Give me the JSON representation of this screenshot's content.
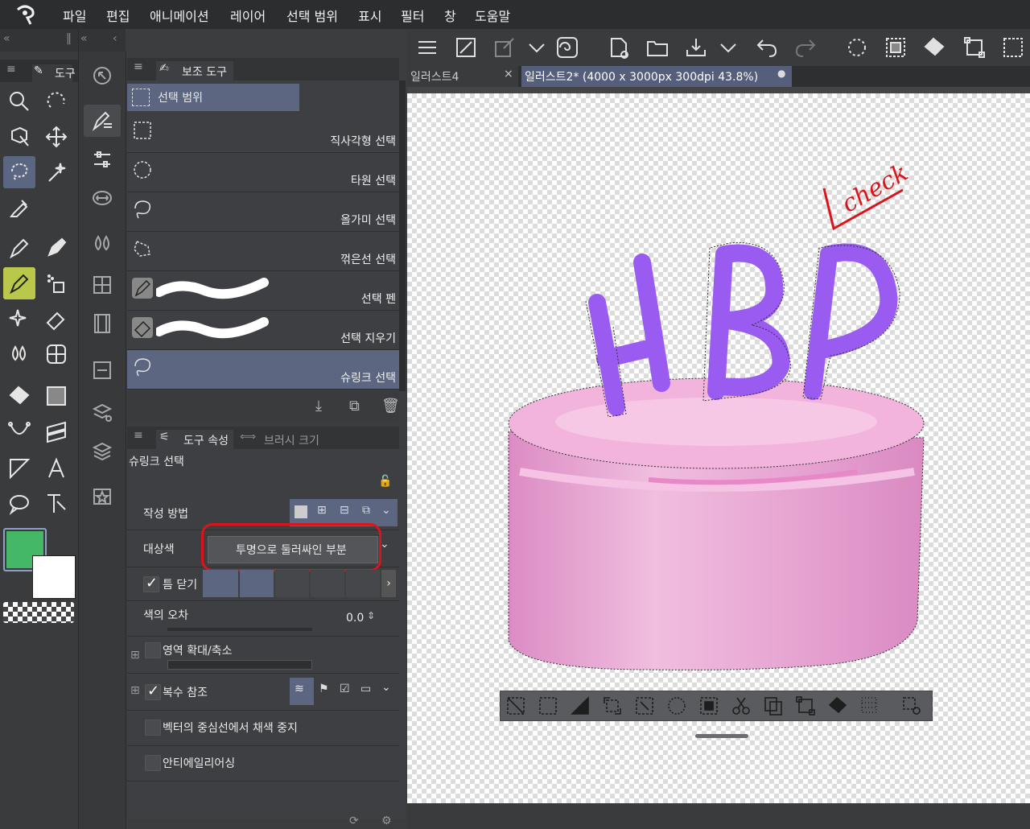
{
  "menubar": {
    "items": [
      "파일",
      "편집",
      "애니메이션",
      "레이어",
      "선택 범위",
      "표시",
      "필터",
      "창",
      "도움말"
    ]
  },
  "tool_panel": {
    "tab_label": "도구"
  },
  "sub_tool_panel": {
    "tab_label": "보조 도구",
    "group_label": "선택 범위",
    "items": [
      {
        "label": "직사각형 선택",
        "icon": "rect-select-icon"
      },
      {
        "label": "타원 선택",
        "icon": "ellipse-select-icon"
      },
      {
        "label": "올가미 선택",
        "icon": "lasso-select-icon"
      },
      {
        "label": "꺾은선 선택",
        "icon": "polyline-select-icon"
      },
      {
        "label": "선택 펜",
        "icon": "selection-pen-icon"
      },
      {
        "label": "선택 지우기",
        "icon": "selection-eraser-icon"
      },
      {
        "label": "슈링크 선택",
        "icon": "shrink-select-icon",
        "selected": true
      }
    ]
  },
  "tool_property": {
    "tab_label": "도구 속성",
    "tab2_label": "브러시 크기",
    "tool_name": "슈링크 선택",
    "creation_method_label": "작성 방법",
    "target_color_label": "대상색",
    "target_color_value": "투명으로 둘러싸인 부분",
    "close_gap_label": "틈 닫기",
    "color_margin_label": "색의 오차",
    "color_margin_value": "0.0",
    "expand_label": "영역 확대/축소",
    "multiple_ref_label": "복수 참조",
    "vector_stop_label": "벡터의 중심선에서 채색 중지",
    "antialias_label": "안티에일리어싱"
  },
  "document_tabs": [
    {
      "label": "일러스트4"
    },
    {
      "label": "일러스트2* (4000 x 3000px 300dpi 43.8%)",
      "active": true
    }
  ],
  "canvas_art": {
    "letters": "HBP",
    "check_text": "check"
  },
  "colors": {
    "main_color": "#45b868",
    "sub_color": "#ffffff",
    "highlight_red": "#d9151b",
    "selection_blue": "#5c6681",
    "cake_pink": "#e8a6d0",
    "letter_purple": "#9a5cf0"
  }
}
